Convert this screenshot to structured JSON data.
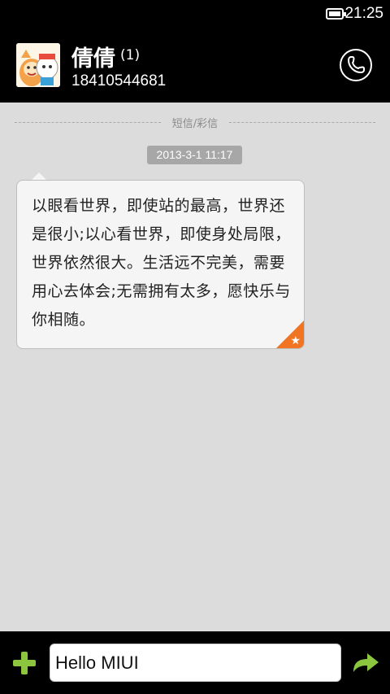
{
  "status_bar": {
    "time": "21:25",
    "icons": [
      "battery-icon"
    ]
  },
  "header": {
    "contact_name": "倩倩",
    "unread_count": "(1)",
    "phone_number": "18410544681",
    "icons": [
      "avatar",
      "phone-icon"
    ]
  },
  "conversation": {
    "thread_type": "短信/彩信",
    "messages": [
      {
        "timestamp": "2013-3-1 11:17",
        "text": "以眼看世界，即使站的最高，世界还是很小;以心看世界，即使身处局限，世界依然很大。生活远不完美，需要用心去体会;无需拥有太多，愿快乐与你相随。",
        "starred": true
      }
    ]
  },
  "compose": {
    "value": "Hello MIUI",
    "icons": [
      "plus-icon",
      "send-arrow-icon"
    ]
  },
  "colors": {
    "background": "#dcdcdd",
    "bar": "#000000",
    "accent_green": "#8cc63f",
    "star_orange": "#f07422"
  }
}
